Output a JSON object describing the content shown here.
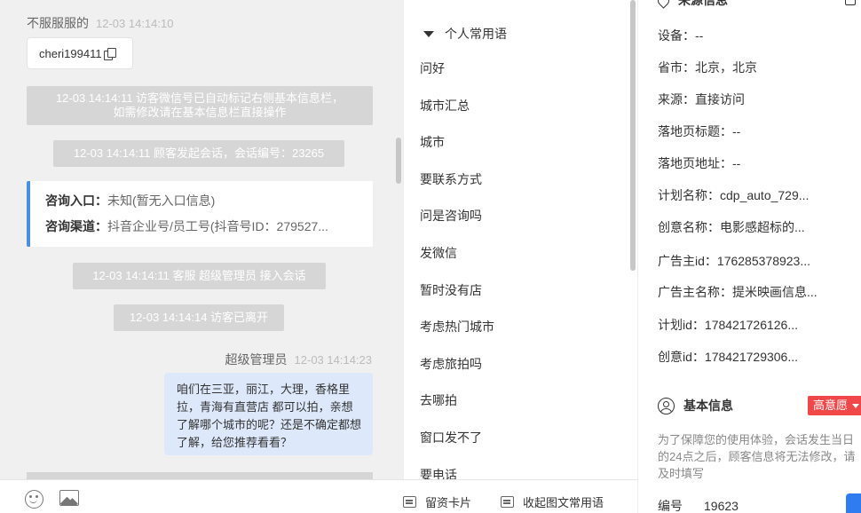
{
  "chat": {
    "visitor_name": "不服服服的",
    "visitor_time": "12-03 14:14:10",
    "copy_card_text": "cheri199411",
    "sys_auto_mark_line1": "12-03 14:14:11 访客微信号已自动标记右侧基本信息栏，",
    "sys_auto_mark_line2": "如需修改请在基本信息栏直接操作",
    "sys_session_start": "12-03 14:14:11 顾客发起会话，会话编号：23265",
    "entry_label": "咨询入口：",
    "entry_value": "未知(暂无入口信息)",
    "channel_label": "咨询渠道：",
    "channel_value": "抖音企业号/员工号(抖音号ID：279527...",
    "sys_agent_join": "12-03 14:14:11 客服 超级管理员 接入会话",
    "sys_visitor_left": "12-03 14:14:14 访客已离开",
    "agent_name": "超级管理员",
    "agent_time": "12-03 14:14:23",
    "agent_message": "咱们在三亚，丽江，大理，香格里拉，青海有直营店 都可以拍，亲想了解哪个城市的呢？还是不确定都想了解，给您推荐看看？"
  },
  "phrases": {
    "group_title": "个人常用语",
    "items": [
      "问好",
      "城市汇总",
      "城市",
      "要联系方式",
      "问是咨询吗",
      "发微信",
      "暂时没有店",
      "考虑热门城市",
      "考虑旅拍吗",
      "去哪拍",
      "窗口发不了",
      "要电话"
    ],
    "lead_card_label": "留资卡片",
    "collapse_label": "收起图文常用语"
  },
  "info": {
    "source_header": "来源信息",
    "fields": [
      {
        "label": "设备：",
        "value": "--"
      },
      {
        "label": "省市：",
        "value": "北京，北京"
      },
      {
        "label": "来源：",
        "value": "直接访问"
      },
      {
        "label": "落地页标题：",
        "value": "--"
      },
      {
        "label": "落地页地址：",
        "value": "--"
      },
      {
        "label": "计划名称：",
        "value": "cdp_auto_729..."
      },
      {
        "label": "创意名称：",
        "value": "电影感超标的..."
      },
      {
        "label": "广告主id：",
        "value": "176285378923..."
      },
      {
        "label": "广告主名称：",
        "value": "提米映画信息..."
      },
      {
        "label": "计划id：",
        "value": "178421726126..."
      },
      {
        "label": "创意id：",
        "value": "178421729306..."
      }
    ],
    "basic_header": "基本信息",
    "intent_badge": "高意愿",
    "note": "为了保障您的使用体验，会话发生当日的24点之后，顾客信息将无法修改，请及时填写",
    "serial_label": "编号",
    "serial_value": "19623"
  },
  "colors": {
    "accent_blue": "#4a90e2",
    "bubble_blue": "#dde9fb",
    "badge_red": "#f04848",
    "system_gray": "#d6d6d6"
  }
}
